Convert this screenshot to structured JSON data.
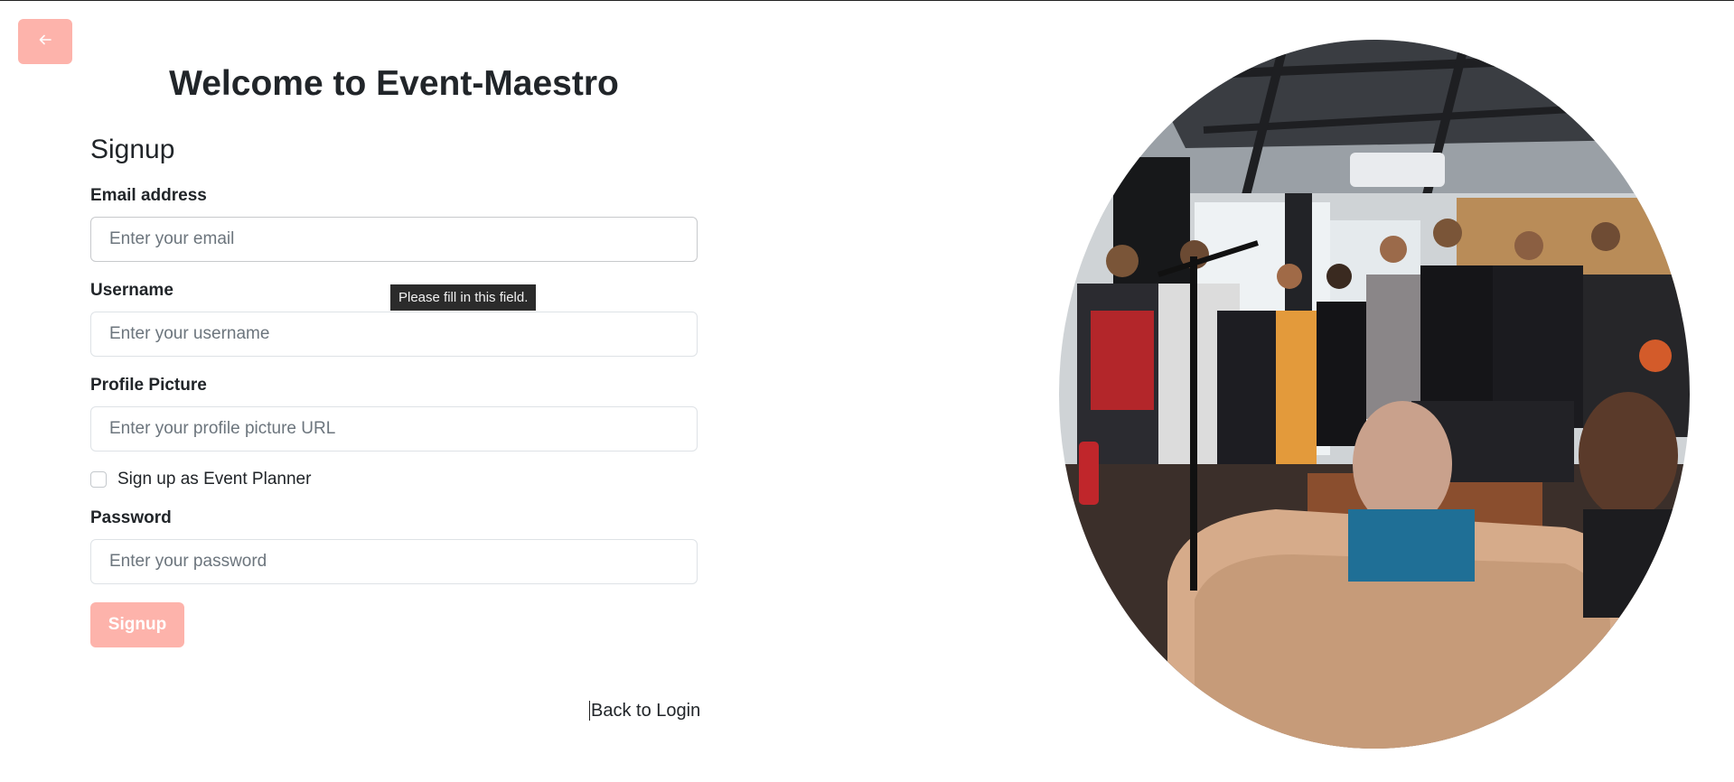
{
  "header": {
    "title": "Welcome to Event-Maestro"
  },
  "form": {
    "heading": "Signup",
    "email": {
      "label": "Email address",
      "placeholder": "Enter your email",
      "value": ""
    },
    "username": {
      "label": "Username",
      "placeholder": "Enter your username",
      "value": ""
    },
    "profile_picture": {
      "label": "Profile Picture",
      "placeholder": "Enter your profile picture URL",
      "value": ""
    },
    "event_planner": {
      "label": "Sign up as Event Planner",
      "checked": false
    },
    "password": {
      "label": "Password",
      "placeholder": "Enter your password",
      "value": ""
    },
    "submit_label": "Signup",
    "back_to_login": "Back to Login"
  },
  "tooltip": {
    "text": "Please fill in this field."
  },
  "icons": {
    "back": "arrow-left-icon"
  },
  "colors": {
    "accent": "#fdb3ab",
    "text": "#212529",
    "tooltip_bg": "#2b2b2b"
  }
}
